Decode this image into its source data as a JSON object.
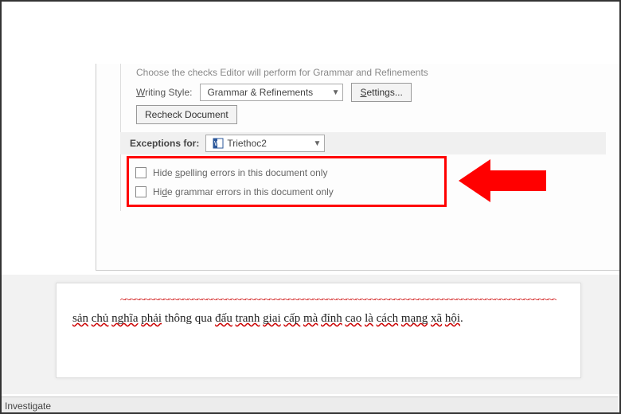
{
  "dialog": {
    "truncated_header": "Choose the checks Editor will perform for Grammar and Refinements",
    "writing_style_label_pre": "W",
    "writing_style_label_rest": "riting Style:",
    "writing_style_value": "Grammar & Refinements",
    "settings_label": "Settings...",
    "settings_u": "S",
    "recheck_label": "Recheck Document",
    "exceptions_label": "Exceptions for:",
    "exceptions_value": "Triethoc2",
    "hide_spelling_pre": "Hide ",
    "hide_spelling_u": "s",
    "hide_spelling_rest": "pelling errors in this document only",
    "hide_grammar_pre": "Hi",
    "hide_grammar_u": "d",
    "hide_grammar_rest": "e grammar errors in this document only"
  },
  "document": {
    "line": "sản chủ nghĩa phải thông qua đấu tranh giai cấp mà đỉnh cao là cách mạng xã hội."
  },
  "status": {
    "investigate": "Investigate"
  }
}
